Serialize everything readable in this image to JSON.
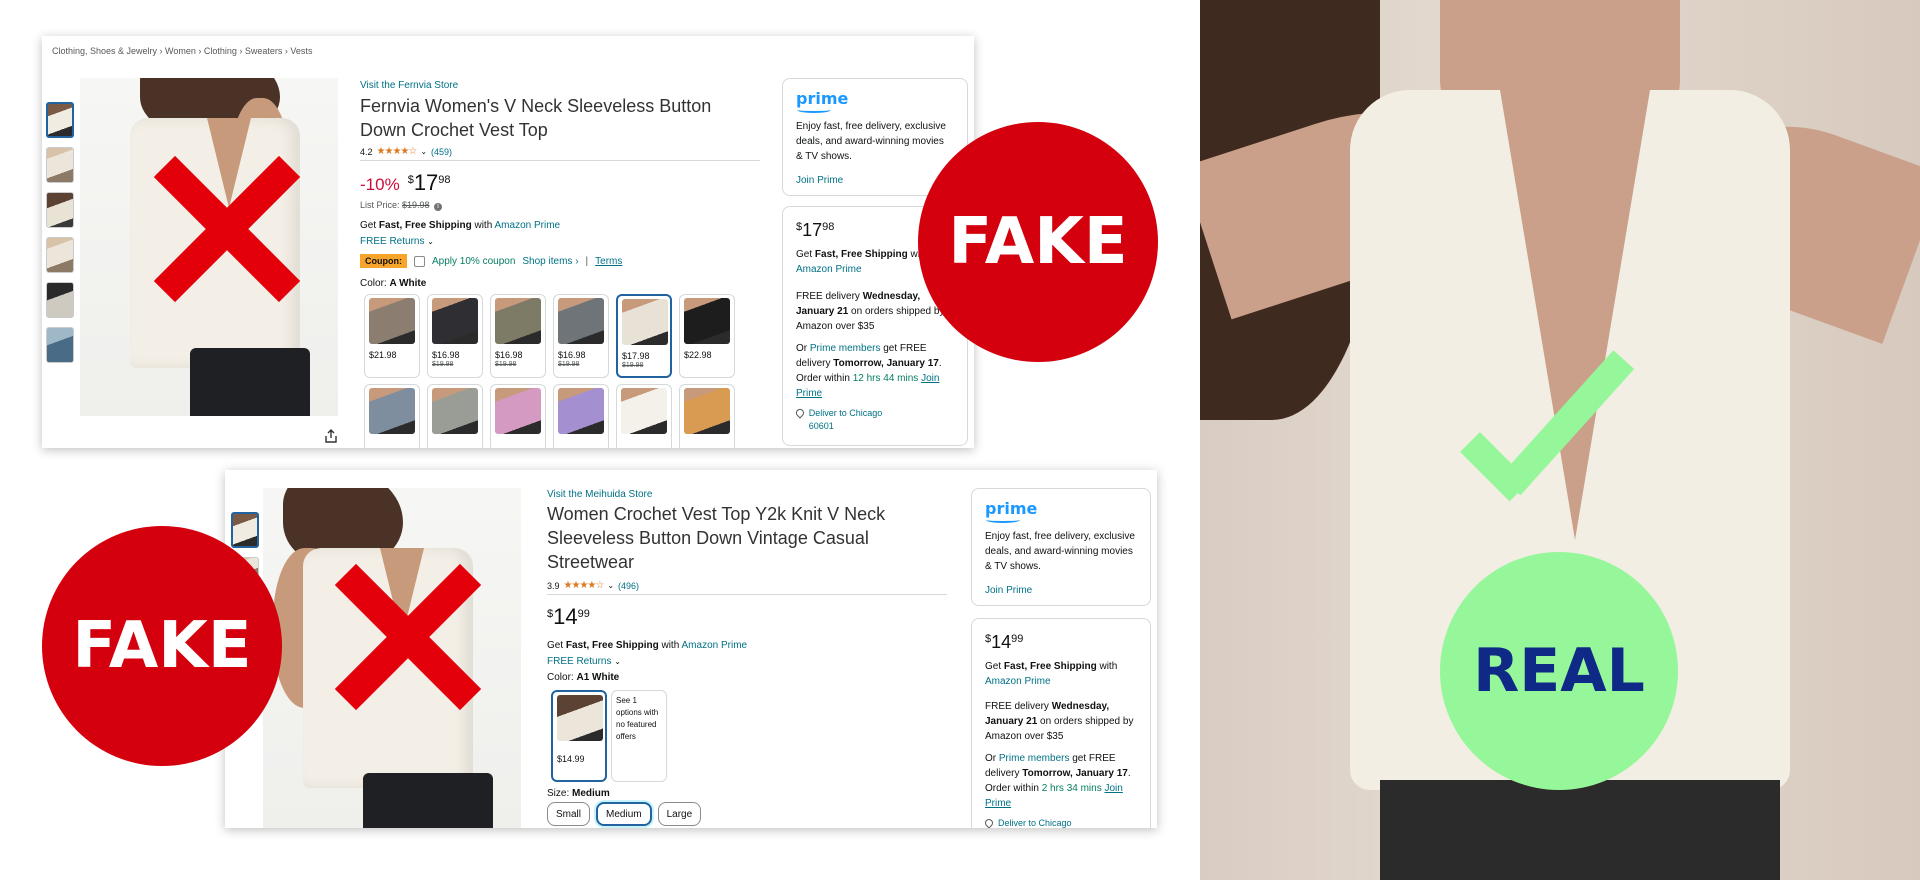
{
  "listing1": {
    "breadcrumb": "Clothing, Shoes & Jewelry › Women › Clothing › Sweaters › Vests",
    "store_link": "Visit the Fernvia Store",
    "title": "Fernvia Women's V Neck Sleeveless Button Down Crochet Vest Top",
    "rating_value": "4.2",
    "rating_stars": "★★★★☆",
    "rating_count": "(459)",
    "discount": "-10%",
    "price_symbol": "$",
    "price_whole": "17",
    "price_fraction": "98",
    "list_price_label": "List Price:",
    "list_price": "$19.98",
    "ship_prefix": "Get",
    "ship_bold": "Fast, Free Shipping",
    "ship_with": "with",
    "ship_link": "Amazon Prime",
    "returns": "FREE Returns",
    "coupon_badge": "Coupon:",
    "coupon_apply": "Apply 10% coupon",
    "shop_items": "Shop items ›",
    "coupon_separator": "|",
    "terms": "Terms",
    "color_label": "Color:",
    "color_value": "A White",
    "swatches": [
      {
        "price": "$21.98",
        "strike": "",
        "color": "#8b7d70"
      },
      {
        "price": "$16.98",
        "strike": "$19.98",
        "color": "#2f2f33"
      },
      {
        "price": "$16.98",
        "strike": "$19.98",
        "color": "#7d7a66"
      },
      {
        "price": "$16.98",
        "strike": "$19.98",
        "color": "#6e7478"
      },
      {
        "price": "$17.98",
        "strike": "$19.98",
        "color": "#e8e2d6"
      },
      {
        "price": "$22.98",
        "strike": "",
        "color": "#1d1d1d"
      },
      {
        "price": "",
        "strike": "",
        "color": "#7f8e9e"
      },
      {
        "price": "",
        "strike": "",
        "color": "#9a9c96"
      },
      {
        "price": "",
        "strike": "",
        "color": "#d59ac2"
      },
      {
        "price": "",
        "strike": "",
        "color": "#a48fd1"
      },
      {
        "price": "",
        "strike": "",
        "color": "#f4f1ea"
      },
      {
        "price": "",
        "strike": "",
        "color": "#d99a52"
      }
    ],
    "prime_logo": "prime",
    "prime_pitch": "Enjoy fast, free delivery, exclusive deals, and award-winning movies & TV shows.",
    "join_prime": "Join Prime",
    "bb_price_symbol": "$",
    "bb_price_whole": "17",
    "bb_price_fraction": "98",
    "bb_ship_prefix": "Get",
    "bb_ship_bold": "Fast, Free Shipping",
    "bb_ship_with": "with",
    "bb_ship_link": "Amazon Prime",
    "bb_free_delivery": "FREE delivery",
    "bb_delivery_date": "Wednesday, January 21",
    "bb_delivery_rest": "on orders shipped by Amazon over $35",
    "bb_or": "Or",
    "bb_prime_members": "Prime members",
    "bb_get_free": "get FREE delivery",
    "bb_tomorrow": "Tomorrow, January 17",
    "bb_order_within": ". Order within",
    "bb_countdown": "12 hrs 44 mins",
    "bb_join_prime": "Join Prime",
    "bb_deliver_to": "Deliver to Chicago 60601"
  },
  "listing2": {
    "store_link": "Visit the Meihuida Store",
    "title": "Women Crochet Vest Top Y2k Knit V Neck Sleeveless Button Down Vintage Casual Streetwear",
    "rating_value": "3.9",
    "rating_stars": "★★★★☆",
    "rating_count": "(496)",
    "price_symbol": "$",
    "price_whole": "14",
    "price_fraction": "99",
    "ship_prefix": "Get",
    "ship_bold": "Fast, Free Shipping",
    "ship_with": "with",
    "ship_link": "Amazon Prime",
    "returns": "FREE Returns",
    "color_label": "Color:",
    "color_value": "A1 White",
    "swatch_price": "$14.99",
    "no_offer_text": "See 1 options with no featured offers",
    "size_label": "Size:",
    "size_value": "Medium",
    "sizes": [
      "Small",
      "Medium",
      "Large"
    ],
    "prime_logo": "prime",
    "prime_pitch": "Enjoy fast, free delivery, exclusive deals, and award-winning movies & TV shows.",
    "join_prime": "Join Prime",
    "bb_price_symbol": "$",
    "bb_price_whole": "14",
    "bb_price_fraction": "99",
    "bb_ship_prefix": "Get",
    "bb_ship_bold": "Fast, Free Shipping",
    "bb_ship_with": "with",
    "bb_ship_link": "Amazon Prime",
    "bb_free_delivery": "FREE delivery",
    "bb_delivery_date": "Wednesday, January 21",
    "bb_delivery_rest": "on orders shipped by Amazon over $35",
    "bb_or": "Or",
    "bb_prime_members": "Prime members",
    "bb_get_free": "get FREE delivery",
    "bb_tomorrow": "Tomorrow, January 17",
    "bb_order_within": ". Order within",
    "bb_countdown": "2 hrs 34 mins",
    "bb_join_prime": "Join Prime",
    "bb_deliver_to": "Deliver to Chicago"
  },
  "badges": {
    "fake_1": "FAKE",
    "fake_2": "FAKE",
    "real": "REAL"
  },
  "colors": {
    "fake_red": "#d4000d",
    "x_red": "#e3000b",
    "real_green": "#96f79a",
    "real_text": "#0e2a86",
    "amazon_link": "#007185",
    "deal_red": "#cc0c39",
    "prime_blue": "#1a98ff",
    "coupon_orange": "#f7a42a"
  },
  "icons": [
    "share-icon",
    "location-pin-icon",
    "chevron-down-icon",
    "info-icon",
    "star-rating-icon",
    "red-x-mark",
    "green-check-mark"
  ]
}
